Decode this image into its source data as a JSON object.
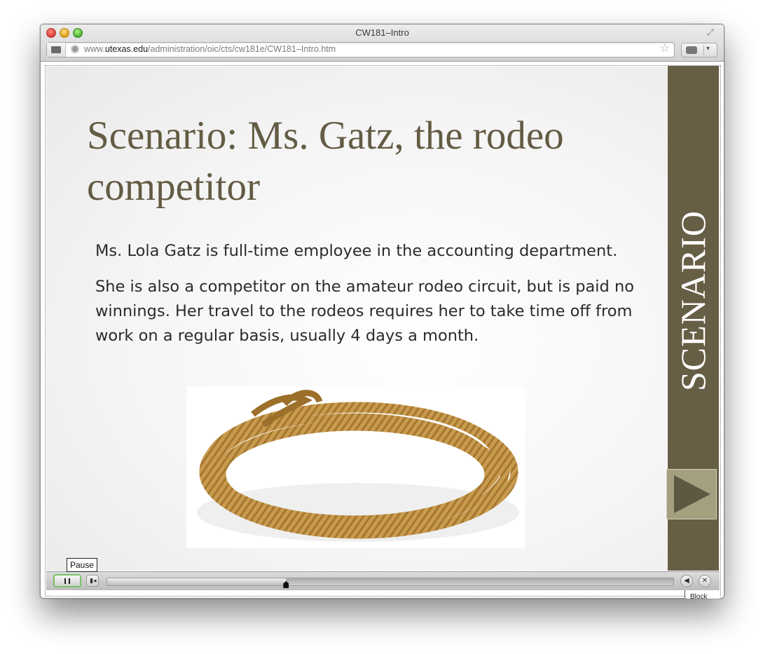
{
  "window": {
    "title": "CW181–Intro"
  },
  "address_bar": {
    "url_prefix": "www.",
    "url_host": "utexas.edu",
    "url_path": "/administration/oic/cts/cw181e/CW181–Intro.htm"
  },
  "slide": {
    "title": "Scenario: Ms. Gatz, the rodeo competitor",
    "paragraphs": [
      "Ms. Lola Gatz is full-time employee in the accounting department.",
      "She is also a competitor on the amateur rodeo circuit, but is paid no winnings. Her travel to the rodeos requires her to take time off from work on a regular basis, usually 4 days a month."
    ],
    "sidebar_label": "SCENARIO",
    "colors": {
      "title": "#645b44",
      "sidebar": "#675e46",
      "next_button": "#a49f7e",
      "next_arrow": "#5e5842"
    }
  },
  "player": {
    "tooltip": "Pause",
    "progress_fraction": 0.316,
    "block_label": "Block",
    "icons": {
      "pause": "pause-icon",
      "rewind": "rewind-to-start-icon",
      "volume": "speaker-icon",
      "close": "close-icon"
    }
  }
}
